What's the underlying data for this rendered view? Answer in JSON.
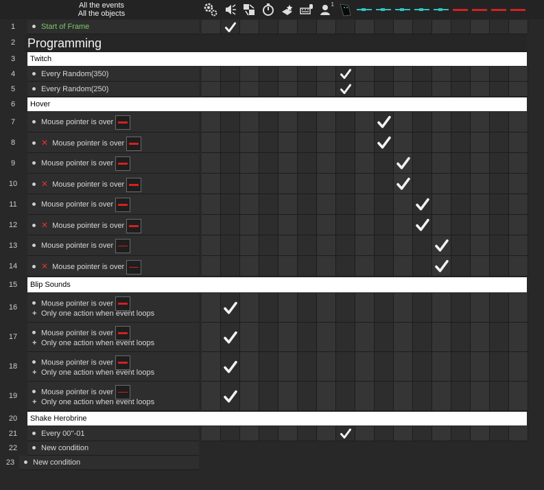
{
  "header": {
    "all_events": "All the events",
    "all_objects": "All the objects"
  },
  "columns": [
    {
      "icon": "gears-icon"
    },
    {
      "icon": "speaker-icon"
    },
    {
      "icon": "storyboard-icon"
    },
    {
      "icon": "timer-icon"
    },
    {
      "icon": "create-object-icon"
    },
    {
      "icon": "keyboard-mouse-icon"
    },
    {
      "icon": "player-icon",
      "badge": "1"
    },
    {
      "icon": "herobrine-icon"
    },
    {
      "icon": "cyan-bar-object-icon"
    },
    {
      "icon": "cyan-bar-object-icon"
    },
    {
      "icon": "cyan-bar-object-icon"
    },
    {
      "icon": "cyan-bar-object-icon"
    },
    {
      "icon": "cyan-bar-object-icon"
    },
    {
      "icon": "red-bar-object-icon"
    },
    {
      "icon": "red-bar-object-icon"
    },
    {
      "icon": "red-bar-object-icon"
    },
    {
      "icon": "red-bar-object-icon"
    }
  ],
  "rows": [
    {
      "num": "1",
      "type": "event",
      "lines": [
        {
          "kind": "bullet",
          "text": "Start of Frame",
          "green": true
        }
      ],
      "checks": [
        1
      ]
    },
    {
      "num": "2",
      "type": "comment",
      "text": "Programming"
    },
    {
      "num": "3",
      "type": "group",
      "text": "Twitch"
    },
    {
      "num": "4",
      "type": "event",
      "lines": [
        {
          "kind": "bullet",
          "text": "Every Random(350)"
        }
      ],
      "checks": [
        7
      ]
    },
    {
      "num": "5",
      "type": "event",
      "lines": [
        {
          "kind": "bullet",
          "text": "Every Random(250)"
        }
      ],
      "checks": [
        7
      ]
    },
    {
      "num": "6",
      "type": "group",
      "text": "Hover"
    },
    {
      "num": "7",
      "type": "event",
      "lines": [
        {
          "kind": "bullet",
          "text": "Mouse pointer is over",
          "obj": "thick"
        }
      ],
      "checks": [
        9
      ]
    },
    {
      "num": "8",
      "type": "event",
      "lines": [
        {
          "kind": "bullet",
          "neg": true,
          "text": "Mouse pointer is over",
          "obj": "thick"
        }
      ],
      "checks": [
        9
      ]
    },
    {
      "num": "9",
      "type": "event",
      "lines": [
        {
          "kind": "bullet",
          "text": "Mouse pointer is over",
          "obj": "thick"
        }
      ],
      "checks": [
        10
      ]
    },
    {
      "num": "10",
      "type": "event",
      "lines": [
        {
          "kind": "bullet",
          "neg": true,
          "text": "Mouse pointer is over",
          "obj": "thick"
        }
      ],
      "checks": [
        10
      ]
    },
    {
      "num": "11",
      "type": "event",
      "lines": [
        {
          "kind": "bullet",
          "text": "Mouse pointer is over",
          "obj": "thick"
        }
      ],
      "checks": [
        11
      ]
    },
    {
      "num": "12",
      "type": "event",
      "lines": [
        {
          "kind": "bullet",
          "neg": true,
          "text": "Mouse pointer is over",
          "obj": "thick"
        }
      ],
      "checks": [
        11
      ]
    },
    {
      "num": "13",
      "type": "event",
      "lines": [
        {
          "kind": "bullet",
          "text": "Mouse pointer is over",
          "obj": "thin"
        }
      ],
      "checks": [
        12
      ]
    },
    {
      "num": "14",
      "type": "event",
      "lines": [
        {
          "kind": "bullet",
          "neg": true,
          "text": "Mouse pointer is over",
          "obj": "thin"
        }
      ],
      "checks": [
        12
      ]
    },
    {
      "num": "15",
      "type": "group",
      "text": "Blip Sounds"
    },
    {
      "num": "16",
      "type": "event",
      "lines": [
        {
          "kind": "bullet",
          "text": "Mouse pointer is over",
          "obj": "thick"
        },
        {
          "kind": "plus",
          "text": "Only one action when event loops"
        }
      ],
      "checks": [
        1
      ]
    },
    {
      "num": "17",
      "type": "event",
      "lines": [
        {
          "kind": "bullet",
          "text": "Mouse pointer is over",
          "obj": "thick"
        },
        {
          "kind": "plus",
          "text": "Only one action when event loops"
        }
      ],
      "checks": [
        1
      ]
    },
    {
      "num": "18",
      "type": "event",
      "lines": [
        {
          "kind": "bullet",
          "text": "Mouse pointer is over",
          "obj": "thick"
        },
        {
          "kind": "plus",
          "text": "Only one action when event loops"
        }
      ],
      "checks": [
        1
      ]
    },
    {
      "num": "19",
      "type": "event",
      "lines": [
        {
          "kind": "bullet",
          "text": "Mouse pointer is over",
          "obj": "thin"
        },
        {
          "kind": "plus",
          "text": "Only one action when event loops"
        }
      ],
      "checks": [
        1
      ]
    },
    {
      "num": "20",
      "type": "group",
      "text": "Shake Herobrine"
    },
    {
      "num": "21",
      "type": "event",
      "lines": [
        {
          "kind": "bullet",
          "text": "Every 00''-01"
        }
      ],
      "checks": [
        7
      ]
    },
    {
      "num": "22",
      "type": "new",
      "lines": [
        {
          "kind": "bullet",
          "text": "New condition"
        }
      ]
    },
    {
      "num": "23",
      "type": "new",
      "indent": true,
      "lines": [
        {
          "kind": "bullet",
          "text": "New condition"
        }
      ]
    }
  ],
  "colors": {
    "accent_green": "#7cc96a",
    "red_object": "#d62020",
    "cyan_object": "#2ec4c4"
  }
}
